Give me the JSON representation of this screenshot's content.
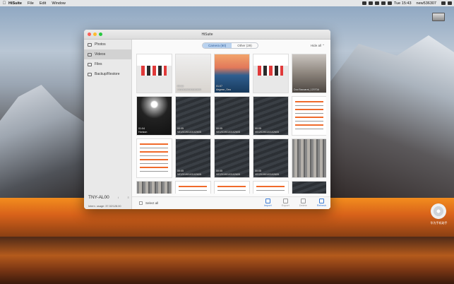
{
  "menubar": {
    "app_name": "HiSuite",
    "menus": [
      "File",
      "Edit",
      "Window"
    ],
    "clock": "Tue 15:43",
    "user": "new536307"
  },
  "desktop": {
    "disk_label": "",
    "cd_label": "华为手机助手"
  },
  "window": {
    "title": "HiSuite"
  },
  "sidebar": {
    "items": [
      {
        "label": "Photos",
        "icon": "photo-icon"
      },
      {
        "label": "Videos",
        "icon": "video-icon"
      },
      {
        "label": "Files",
        "icon": "folder-icon"
      },
      {
        "label": "Backup/Restore",
        "icon": "backup-icon"
      }
    ],
    "active_index": 1,
    "device_name": "TNY-AL00",
    "device_info_glyph": "i",
    "device_menu_glyph": "≡",
    "storage_label": "Intern. usage:",
    "storage_value": "37.02/128.00",
    "storage_fraction": 0.29
  },
  "tabs": [
    {
      "label": "Camera (60)",
      "active": true
    },
    {
      "label": "Other (29)",
      "active": false
    }
  ],
  "hide_all": "Hide all",
  "thumbnails": [
    {
      "style": "screen",
      "line1": "",
      "line2": ""
    },
    {
      "style": "gray",
      "line1": "00:13",
      "line2": "VID20190103101604"
    },
    {
      "style": "sea",
      "line1": "01:07",
      "line2": "Aegean_Sea"
    },
    {
      "style": "screen",
      "line1": "",
      "line2": ""
    },
    {
      "style": "girls",
      "line1": "",
      "line2": "Doc Baccarat_12070A"
    },
    {
      "style": "concert",
      "line1": "01:04",
      "line2": "Horizon"
    },
    {
      "style": "dark",
      "line1": "00:05",
      "line2": "VID20190103102605"
    },
    {
      "style": "dark",
      "line1": "00:05",
      "line2": "VID20190103102605"
    },
    {
      "style": "dark",
      "line1": "00:05",
      "line2": "VID20190103102605"
    },
    {
      "style": "doc",
      "line1": "",
      "line2": ""
    },
    {
      "style": "doc",
      "line1": "",
      "line2": ""
    },
    {
      "style": "dark",
      "line1": "00:05",
      "line2": "VID20190103102605"
    },
    {
      "style": "dark",
      "line1": "00:05",
      "line2": "VID20190103102605"
    },
    {
      "style": "dark",
      "line1": "00:05",
      "line2": "VID20190103102605"
    },
    {
      "style": "wood",
      "line1": "",
      "line2": ""
    },
    {
      "style": "wood",
      "line1": "",
      "line2": ""
    },
    {
      "style": "doc",
      "line1": "",
      "line2": ""
    },
    {
      "style": "doc",
      "line1": "",
      "line2": ""
    },
    {
      "style": "doc",
      "line1": "",
      "line2": ""
    },
    {
      "style": "dark",
      "line1": "",
      "line2": ""
    }
  ],
  "bottom": {
    "select_all": "Select all",
    "actions": [
      {
        "label": "Import",
        "enabled": true
      },
      {
        "label": "Export",
        "enabled": false
      },
      {
        "label": "Delete",
        "enabled": false
      },
      {
        "label": "Refresh",
        "enabled": true
      }
    ]
  }
}
